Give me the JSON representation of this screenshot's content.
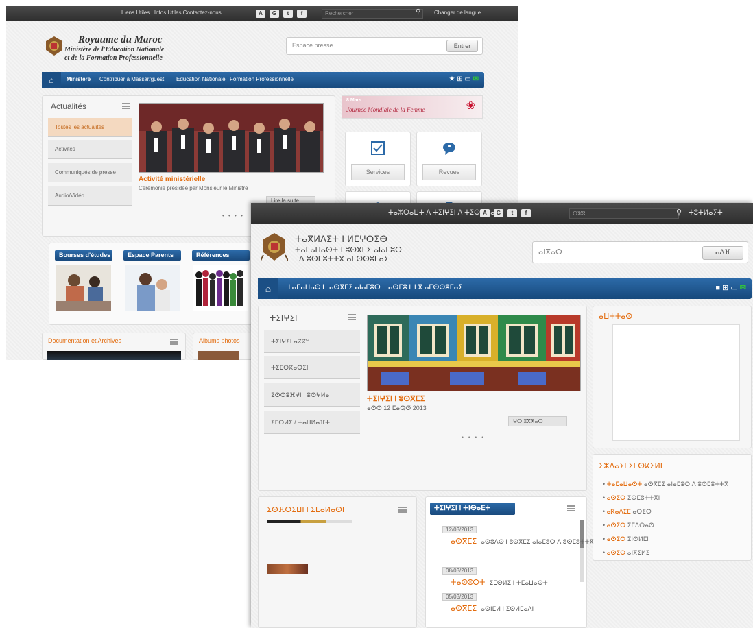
{
  "back_screenshot": {
    "topbar": {
      "links": "Liens Utiles | Infos Utiles  Contactez-nous",
      "social": [
        "A",
        "G",
        "t",
        "f"
      ],
      "search_placeholder": "Rechercher",
      "lang": "Changer de langue"
    },
    "header": {
      "title_line1": "Royaume du Maroc",
      "title_line2": "Ministère de l'Education Nationale",
      "title_line3": "et de la Formation Professionnelle"
    },
    "search": {
      "placeholder": "Espace presse",
      "button": "Entrer"
    },
    "nav": {
      "items": [
        "Ministère",
        "Contribuer à Massar/guest",
        "Education Nationale",
        "Formation Professionnelle"
      ]
    },
    "news": {
      "title": "Actualités",
      "tabs": [
        "Toutes les actualités",
        "Activités",
        "Communiqués de presse",
        "Audio/Vidéo"
      ],
      "headline": "Activité ministérielle",
      "subline": "Cérémonie présidée par Monsieur le Ministre",
      "more": "Lire la suite",
      "dots": "• • • •"
    },
    "banner": {
      "line1": "8 Mars",
      "line2": "Journée Mondiale de la Femme"
    },
    "tiles": [
      "Services",
      "Revues"
    ],
    "feature_tabs": [
      "Bourses d'études",
      "Espace Parents",
      "Références"
    ],
    "bottom_tabs": [
      "Documentation et Archives",
      "Albums photos"
    ]
  },
  "front_screenshot": {
    "topbar": {
      "links": "ⵜⴰⵣⵔⴰⵡⵜ ⴷ ⵜⵉⵏⵖⵉⵏ ⴷ ⵜⵉⵙⵓⵔⴰ",
      "social": [
        "A",
        "G",
        "t",
        "f"
      ],
      "search_placeholder": "ⵔⵣⵓ",
      "lang": "ⵜⵓⵜⵍⴰⵢⵜ"
    },
    "header": {
      "title_line1": "ⵜⴰⴳⵍⴷⵉⵜ ⵏ ⵍⵎⵖⵔⵉⴱ",
      "title_line2": "ⵜⴰⵎⴰⵡⴰⵙⵜ ⵏ ⵓⵙⴳⵎⵉ ⴰⵏⴰⵎⵓⵔ",
      "title_line3": "ⴷ ⵓⵙⵎⵓⵜⵜⴳ ⴰⵎⵙⵙⵓⵎⴰⵢ"
    },
    "search": {
      "placeholder": "ⴰⵏⴳⴰⵔ",
      "button": "ⴰⴷⴼ"
    },
    "nav": {
      "items": [
        "ⵜⴰⵎⴰⵡⴰⵙⵜ",
        "ⴰⵙⴳⵎⵉ ⴰⵏⴰⵎⵓⵔ",
        "ⴰⵙⵎⵓⵜⵜⴳ ⴰⵎⵙⵙⵓⵎⴰⵢ"
      ]
    },
    "news": {
      "title": "ⵜⵉⵏⵖⵉⵏ",
      "tabs": [
        "ⵜⵉⵏⵖⵉⵏ ⴰⴽⴽⵯ",
        "ⵜⵉⵎⵙⴽⴰⵔⵉⵏ",
        "ⵉⵙⵙⵓⴼⵖⵏ ⵏ ⵓⵙⵖⵍⴰ",
        "ⵉⵎⵙⵍⵉ / ⵜⴰⵡⵍⴰⴼⵜ"
      ],
      "headline": "ⵜⵉⵏⵖⵉⵏ ⵏ ⵓⵙⴳⵎⵉ",
      "subline": "ⴰⵙⵙ 12 ⵎⴰⵕⵚ 2013",
      "more": "ⵖⵔ ⵓⴳⴳⴰⵔ",
      "dots": "• • • •"
    },
    "side_panels": {
      "calendar_title": "ⴰⵡⵜⵜⴰⵙ",
      "links_title": "ⵉⵣⴷⴰⵢⵏ ⵉⵎⵙⴽⵉⵍⵏ"
    },
    "links": [
      {
        "o": "ⵜⴰⵎⴰⵡⴰⵙⵜ",
        "t": "ⴰⵙⴳⵎⵉ ⴰⵏⴰⵎⵓⵔ ⴷ ⵓⵙⵎⵓⵜⵜⴳ"
      },
      {
        "o": "ⴰⵙⵉⵔ",
        "t": "ⵉⵙⵎⵓⵜⵜⴳⵏ"
      },
      {
        "o": "ⴰⴽⴰⴷⵉⵎ",
        "t": "ⴰⵙⵉⵔ"
      },
      {
        "o": "ⴰⵙⵉⵔ",
        "t": "ⵉⵎⴷⵔⴰⵙ"
      },
      {
        "o": "ⴰⵙⵉⵔ",
        "t": "ⵉⵏⵙⵍⵎⵏ"
      },
      {
        "o": "ⴰⵙⵉⵔ",
        "t": "ⴰⵏⴳⵉⵍⵉ"
      }
    ],
    "bottom_left_title": "ⵉⵙⴼⵔⵉⵡⵏ ⵏ ⵉⵎⴰⵍⴰⵙⵏ",
    "bottom_mid_title": "ⵜⵉⵏⵖⵉⵏ ⵏ ⵜⵏⴱⴰⴹⵜ",
    "events": [
      {
        "date": "12/03/2013",
        "o": "ⴰⵙⴳⵎⵉ",
        "t": "ⴰⵙⵓⴷⵙ ⵏ ⵓⵙⴳⵎⵉ ⴰⵏⴰⵎⵓⵔ ⴷ ⵓⵙⵎⵓⵜⵜⴳ"
      },
      {
        "date": "08/03/2013",
        "o": "ⵜⴰⵙⵓⵔⵜ",
        "t": "ⵉⵎⵙⵍⵉ ⵏ ⵜⵎⴰⵡⴰⵙⵜ"
      },
      {
        "date": "05/03/2013",
        "o": "ⴰⵙⴳⵎⵉ",
        "t": "ⴰⵙⵏⵎⵍ ⵏ ⵉⵙⵍⵎⴰⴷⵏ"
      }
    ]
  }
}
